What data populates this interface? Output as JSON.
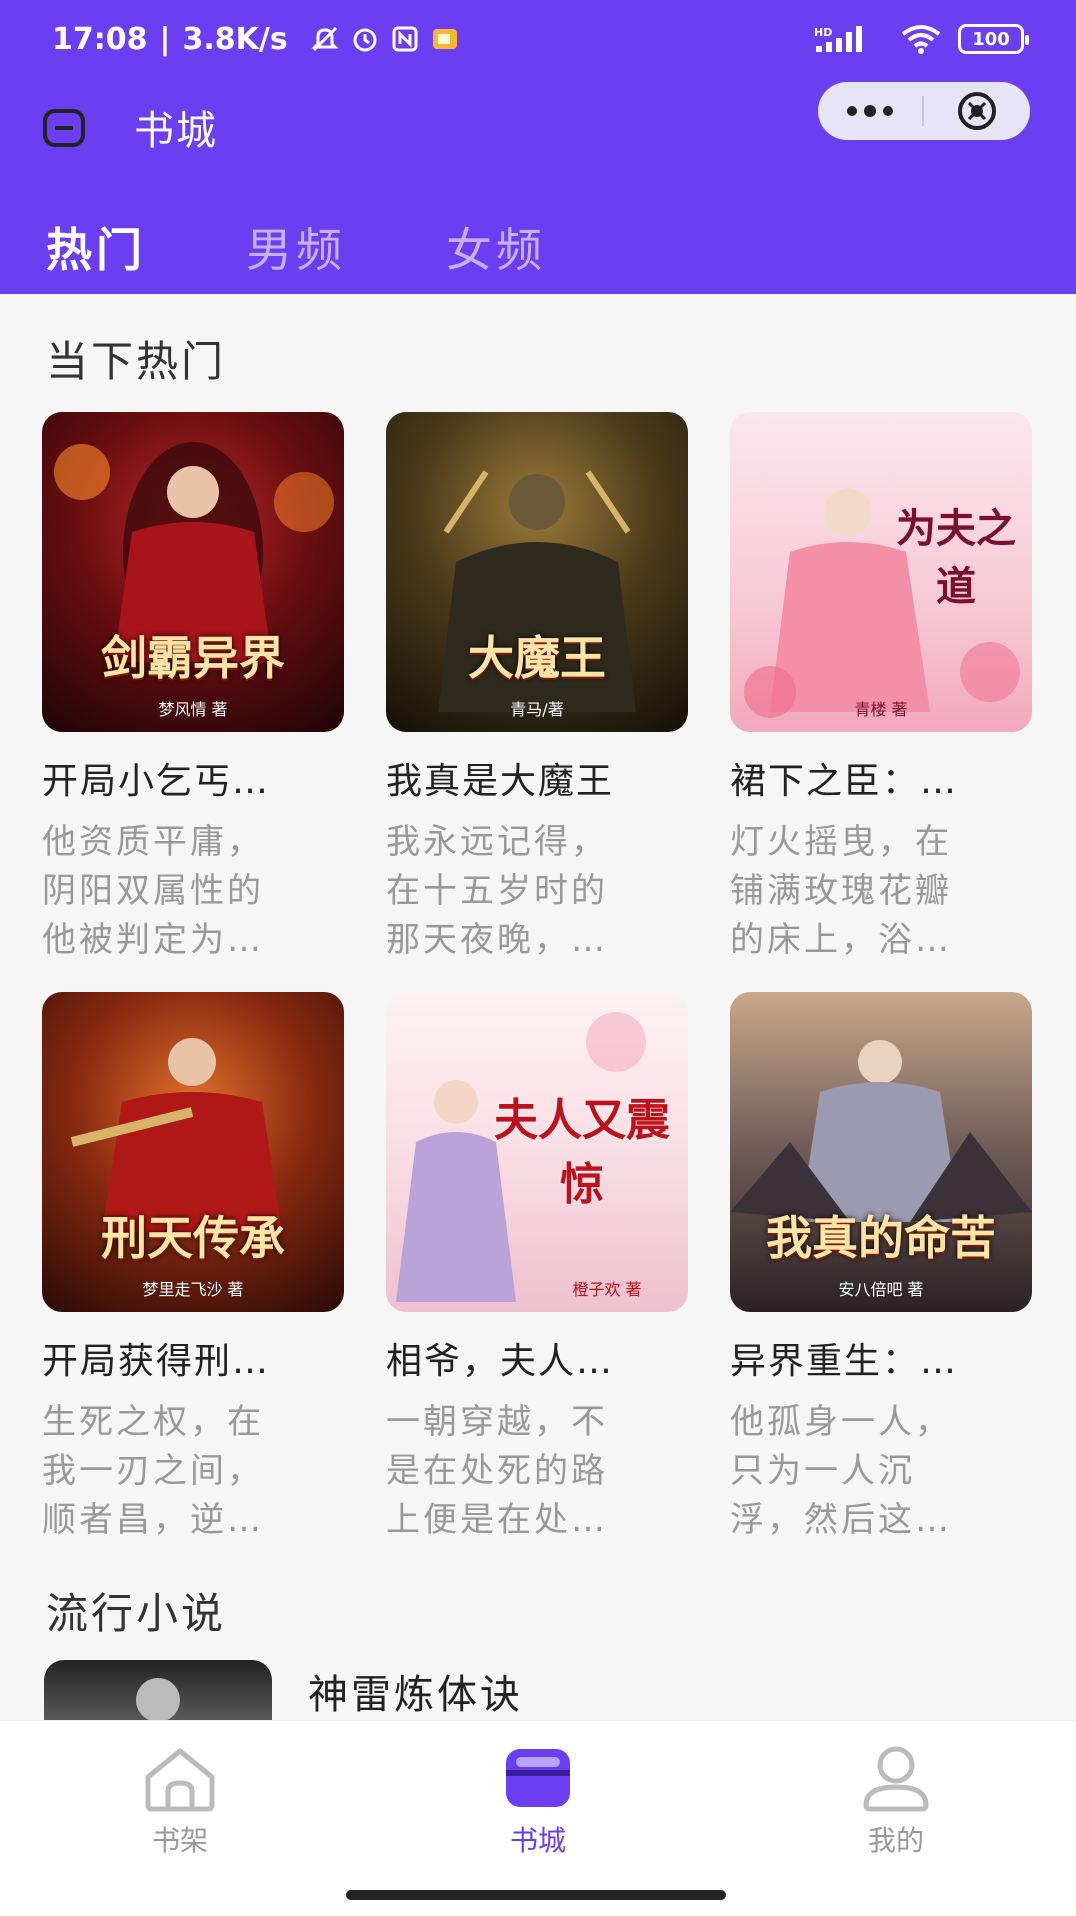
{
  "status_bar": {
    "time": "17:08",
    "network_speed": "3.8K/s",
    "battery": "100",
    "signal": "HD"
  },
  "header": {
    "title": "书城",
    "tabs": [
      {
        "label": "热门",
        "active": true
      },
      {
        "label": "男频",
        "active": false
      },
      {
        "label": "女频",
        "active": false
      }
    ]
  },
  "hot": {
    "section_title": "当下热门",
    "books": [
      {
        "name": "开局小乞丐…",
        "desc": [
          "他资质平庸，",
          "阴阳双属性的",
          "他被判定为…"
        ],
        "cover_title": "剑霸异界",
        "cover_author": "梦风情 著"
      },
      {
        "name": "我真是大魔王",
        "desc": [
          "我永远记得，",
          "在十五岁时的",
          "那天夜晚，…"
        ],
        "cover_title": "大魔王",
        "cover_author": "青马/著"
      },
      {
        "name": "裙下之臣：…",
        "desc": [
          "灯火摇曳，在",
          "铺满玫瑰花瓣",
          "的床上，浴…"
        ],
        "cover_title": "为夫之道",
        "cover_author": "青楼 著"
      },
      {
        "name": "开局获得刑…",
        "desc": [
          "生死之权，在",
          "我一刃之间，",
          "顺者昌，逆…"
        ],
        "cover_title": "刑天传承",
        "cover_author": "梦里走飞沙 著"
      },
      {
        "name": "相爷，夫人…",
        "desc": [
          "一朝穿越，不",
          "是在处死的路",
          "上便是在处…"
        ],
        "cover_title": "夫人又震惊",
        "cover_author": "橙子欢 著"
      },
      {
        "name": "异界重生：…",
        "desc": [
          "他孤身一人，",
          "只为一人沉",
          "浮，然后这…"
        ],
        "cover_title": "我真的命苦",
        "cover_author": "安八倍吧 著"
      }
    ]
  },
  "popular": {
    "section_title": "流行小说",
    "items": [
      {
        "title": "神雷炼体诀"
      }
    ]
  },
  "bottom_nav": [
    {
      "label": "书架",
      "icon": "bookshelf-icon",
      "active": false
    },
    {
      "label": "书城",
      "icon": "bookstore-icon",
      "active": true
    },
    {
      "label": "我的",
      "icon": "profile-icon",
      "active": false
    }
  ],
  "colors": {
    "brand": "#6c3ef2",
    "text_primary": "#222222",
    "text_secondary": "#999999"
  }
}
